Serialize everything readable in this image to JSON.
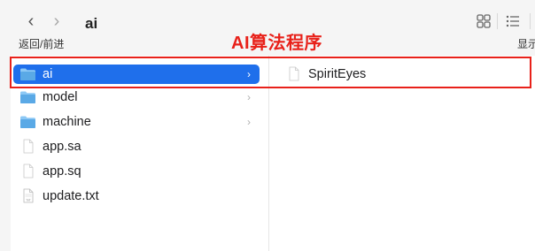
{
  "toolbar": {
    "title": "ai",
    "back_glyph": "‹",
    "forward_glyph": "›",
    "nav_label": "返回/前进",
    "display_label": "显示",
    "grid_view_icon": "grid-view-icon",
    "list_view_icon": "list-view-icon"
  },
  "annotation": {
    "text": "AI算法程序",
    "color": "#e8211a"
  },
  "left_column": {
    "items": [
      {
        "name": "ai",
        "type": "folder",
        "selected": true,
        "chevron": "›"
      },
      {
        "name": "model",
        "type": "folder",
        "selected": false,
        "chevron": "›"
      },
      {
        "name": "machine",
        "type": "folder",
        "selected": false,
        "chevron": "›"
      },
      {
        "name": "app.sa",
        "type": "file"
      },
      {
        "name": "app.sq",
        "type": "file"
      },
      {
        "name": "update.txt",
        "type": "txt-file",
        "icon_text": "TXT"
      }
    ]
  },
  "right_column": {
    "items": [
      {
        "name": "SpiritEyes",
        "type": "file"
      }
    ]
  },
  "colors": {
    "selection": "#1f6feb",
    "folder": "#5aa9e6",
    "highlight": "#e8211a"
  }
}
